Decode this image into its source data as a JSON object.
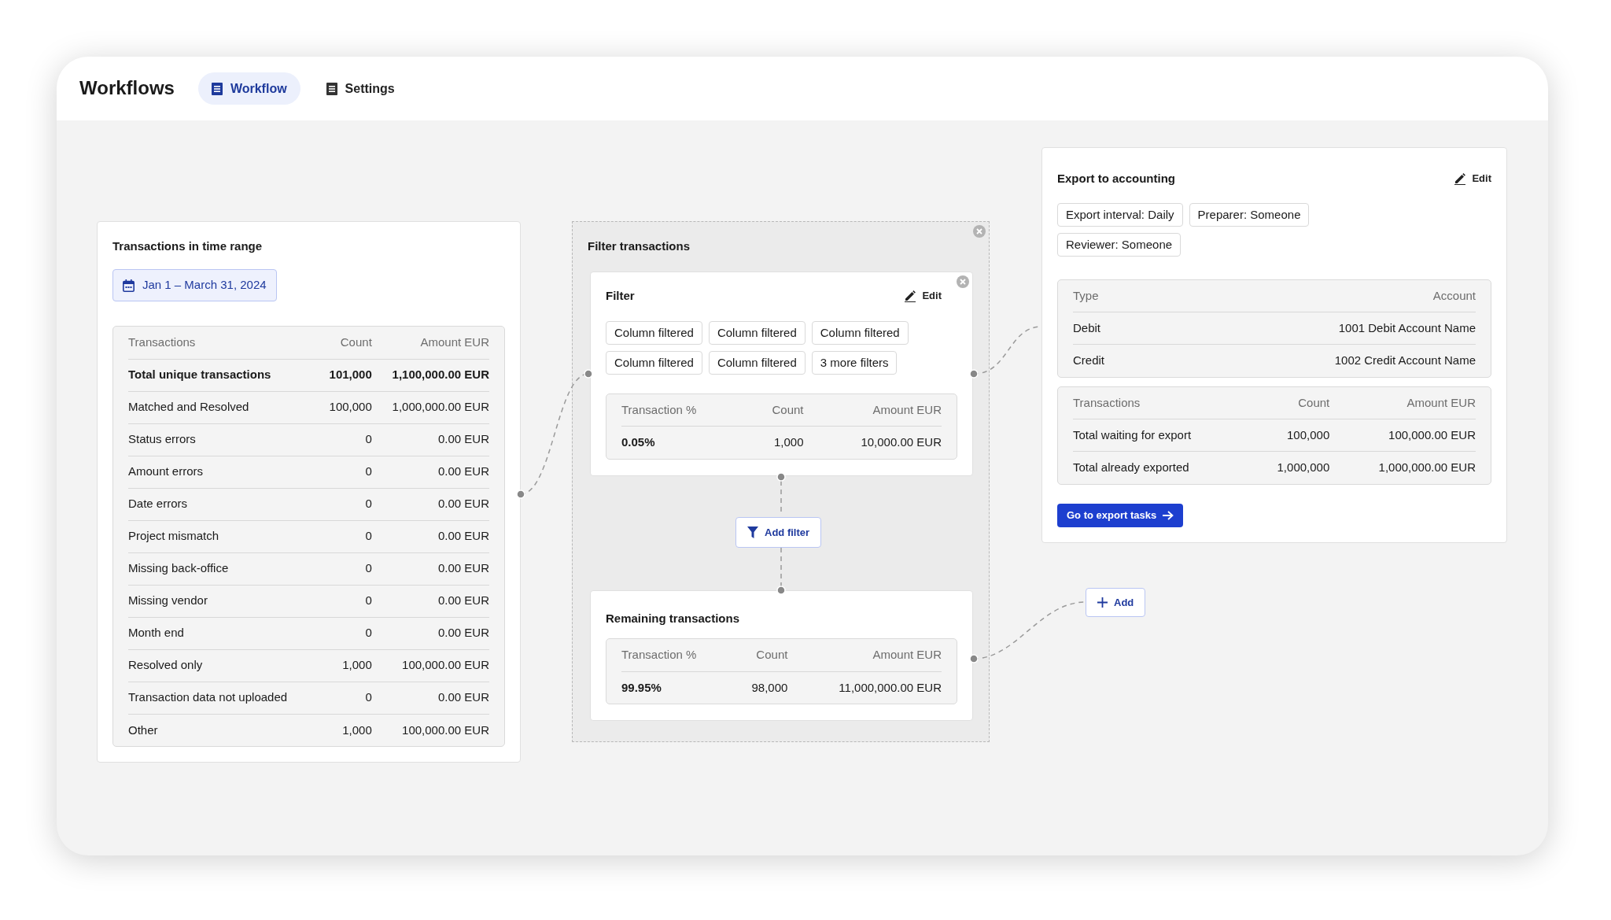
{
  "header": {
    "title": "Workflows",
    "tabs": [
      {
        "label": "Workflow",
        "selected": true
      },
      {
        "label": "Settings",
        "selected": false
      }
    ]
  },
  "time_range_card": {
    "title": "Transactions in time range",
    "date_range": "Jan 1 – March 31, 2024",
    "table": {
      "columns": [
        "Transactions",
        "Count",
        "Amount EUR"
      ],
      "rows": [
        {
          "kind": "total",
          "cells": [
            "Total unique transactions",
            "101,000",
            "1,100,000.00 EUR"
          ]
        },
        {
          "kind": "item",
          "cells": [
            "Matched and Resolved",
            "100,000",
            "1,000,000.00 EUR"
          ]
        },
        {
          "kind": "item",
          "cells": [
            "Status errors",
            "0",
            "0.00 EUR"
          ]
        },
        {
          "kind": "item",
          "cells": [
            "Amount errors",
            "0",
            "0.00 EUR"
          ]
        },
        {
          "kind": "item",
          "cells": [
            "Date errors",
            "0",
            "0.00 EUR"
          ]
        },
        {
          "kind": "item",
          "cells": [
            "Project mismatch",
            "0",
            "0.00 EUR"
          ]
        },
        {
          "kind": "item",
          "cells": [
            "Missing back-office",
            "0",
            "0.00 EUR"
          ]
        },
        {
          "kind": "item",
          "cells": [
            "Missing vendor",
            "0",
            "0.00 EUR"
          ]
        },
        {
          "kind": "item",
          "cells": [
            "Month end",
            "0",
            "0.00 EUR"
          ]
        },
        {
          "kind": "item",
          "cells": [
            "Resolved only",
            "1,000",
            "100,000.00 EUR"
          ]
        },
        {
          "kind": "item",
          "cells": [
            "Transaction data not uploaded",
            "0",
            "0.00 EUR"
          ]
        },
        {
          "kind": "item",
          "cells": [
            "Other",
            "1,000",
            "100,000.00 EUR"
          ]
        }
      ]
    }
  },
  "filter_group": {
    "title": "Filter transactions",
    "filter_card": {
      "title": "Filter",
      "edit_label": "Edit",
      "chips": [
        "Column filtered",
        "Column filtered",
        "Column filtered",
        "Column filtered",
        "Column filtered",
        "3 more filters"
      ],
      "table": {
        "columns": [
          "Transaction %",
          "Count",
          "Amount EUR"
        ],
        "rows": [
          {
            "kind": "summary",
            "cells": [
              "0.05%",
              "1,000",
              "10,000.00 EUR"
            ]
          }
        ]
      }
    },
    "add_filter_label": "Add filter",
    "remaining_card": {
      "title": "Remaining transactions",
      "table": {
        "columns": [
          "Transaction %",
          "Count",
          "Amount EUR"
        ],
        "rows": [
          {
            "kind": "summary",
            "cells": [
              "99.95%",
              "98,000",
              "11,000,000.00 EUR"
            ]
          }
        ]
      }
    }
  },
  "export_card": {
    "title": "Export to accounting",
    "edit_label": "Edit",
    "chips": [
      "Export interval: Daily",
      "Preparer: Someone",
      "Reviewer: Someone"
    ],
    "accounts_table": {
      "columns": [
        "Type",
        "Account"
      ],
      "rows": [
        {
          "cells": [
            "Debit",
            "1001 Debit Account Name"
          ]
        },
        {
          "cells": [
            "Credit",
            "1002 Credit Account Name"
          ]
        }
      ]
    },
    "totals_table": {
      "columns": [
        "Transactions",
        "Count",
        "Amount EUR"
      ],
      "rows": [
        {
          "cells": [
            "Total waiting for export",
            "100,000",
            "100,000.00 EUR"
          ]
        },
        {
          "cells": [
            "Total already exported",
            "1,000,000",
            "1,000,000.00 EUR"
          ]
        }
      ]
    },
    "button_label": "Go to export tasks"
  },
  "add_button_label": "Add"
}
